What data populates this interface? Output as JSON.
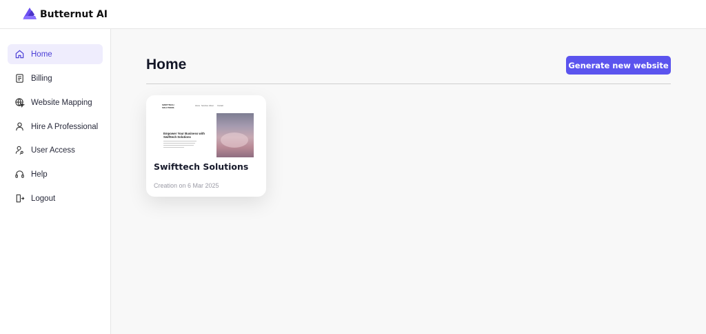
{
  "app": {
    "name": "Butternut AI",
    "logo_icon": "butternut-logo-icon",
    "accent_color": "#5b54ee"
  },
  "sidebar": {
    "items": [
      {
        "label": "Home",
        "icon": "home-icon",
        "active": true
      },
      {
        "label": "Billing",
        "icon": "receipt-icon",
        "active": false
      },
      {
        "label": "Website Mapping",
        "icon": "globe-cursor-icon",
        "active": false
      },
      {
        "label": "Hire A Professional",
        "icon": "person-icon",
        "active": false
      },
      {
        "label": "User Access",
        "icon": "user-key-icon",
        "active": false
      },
      {
        "label": "Help",
        "icon": "headset-icon",
        "active": false
      },
      {
        "label": "Logout",
        "icon": "logout-icon",
        "active": false
      }
    ]
  },
  "main": {
    "title": "Home",
    "generate_button": "Generate new website"
  },
  "websites": [
    {
      "title": "Swifttech Solutions",
      "created": "Creation on 6 Mar 2025",
      "preview": {
        "logo": "SWIFTTECH SOLUTIONS",
        "nav": [
          "Home",
          "Services",
          "About",
          "Contact"
        ],
        "headline": "Empower Your Business with Swifttech Solutions"
      }
    }
  ]
}
